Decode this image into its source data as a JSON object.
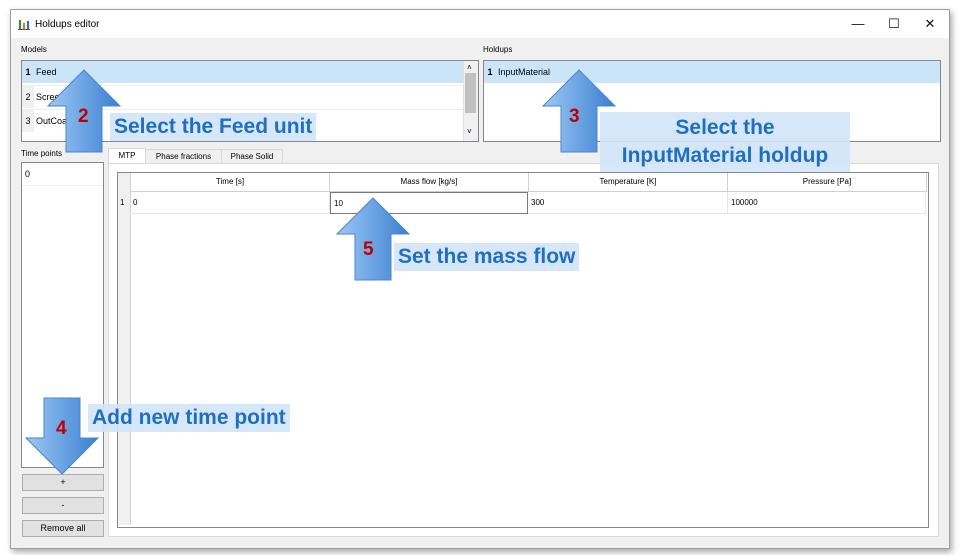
{
  "window": {
    "title": "Holdups editor",
    "minimize": "—",
    "maximize": "☐",
    "close": "✕"
  },
  "models": {
    "label": "Models",
    "items": [
      {
        "num": "1",
        "name": "Feed"
      },
      {
        "num": "2",
        "name": "Screen"
      },
      {
        "num": "3",
        "name": "OutCoa"
      }
    ]
  },
  "holdups": {
    "label": "Holdups",
    "items": [
      {
        "num": "1",
        "name": "InputMaterial"
      }
    ]
  },
  "time_points": {
    "label": "Time points",
    "items": [
      "0"
    ],
    "add_label": "+",
    "remove_label": "-",
    "remove_all_label": "Remove all"
  },
  "tabs": [
    "MTP",
    "Phase fractions",
    "Phase Solid"
  ],
  "grid": {
    "headers": [
      "Time [s]",
      "Mass flow [kg/s]",
      "Temperature [K]",
      "Pressure [Pa]"
    ],
    "rows": [
      {
        "num": "1",
        "cells": [
          "0",
          "10",
          "300",
          "100000"
        ]
      }
    ]
  },
  "callouts": {
    "step2": {
      "num": "2",
      "text": "Select the Feed unit"
    },
    "step3": {
      "num": "3",
      "line1": "Select the",
      "line2": "InputMaterial holdup"
    },
    "step4": {
      "num": "4",
      "text": "Add new time point"
    },
    "step5": {
      "num": "5",
      "text": "Set the mass flow"
    }
  },
  "colors": {
    "callout_text": "#1f6fc1",
    "step_number": "#c00000",
    "arrow_fill": "#6aa5e8"
  }
}
